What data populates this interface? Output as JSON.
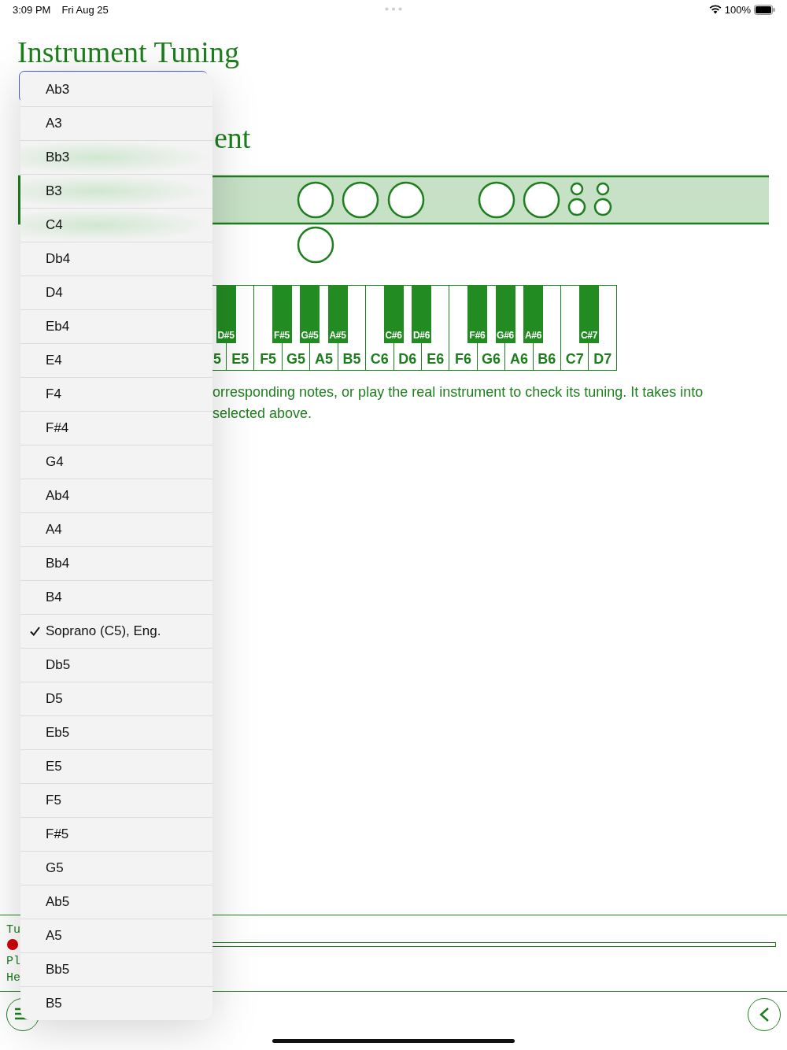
{
  "status_bar": {
    "time": "3:09 PM",
    "date": "Fri Aug 25",
    "battery": "100%"
  },
  "title": "Instrument Tuning",
  "heading_fragment": "ent",
  "keyboard": {
    "white_keys": [
      {
        "label": "5",
        "sharp": "D#5"
      },
      {
        "label": "E5"
      },
      {
        "label": "F5",
        "sharp": "F#5"
      },
      {
        "label": "G5",
        "sharp": "G#5"
      },
      {
        "label": "A5",
        "sharp": "A#5"
      },
      {
        "label": "B5"
      },
      {
        "label": "C6",
        "sharp": "C#6"
      },
      {
        "label": "D6",
        "sharp": "D#6"
      },
      {
        "label": "E6"
      },
      {
        "label": "F6",
        "sharp": "F#6"
      },
      {
        "label": "G6",
        "sharp": "G#6"
      },
      {
        "label": "A6",
        "sharp": "A#6"
      },
      {
        "label": "B6"
      },
      {
        "label": "C7",
        "sharp": "C#7"
      },
      {
        "label": "D7"
      }
    ]
  },
  "paragraph_lines": [
    "orresponding notes, or play the real instrument to check its tuning. It takes into",
    "selected above."
  ],
  "level_bar": {
    "level": 0
  },
  "console": [
    {
      "kind": "text",
      "text": "Tu"
    },
    {
      "kind": "dot"
    },
    {
      "kind": "text",
      "text": "Pl"
    },
    {
      "kind": "text",
      "text": "He"
    }
  ],
  "menu": {
    "items": [
      {
        "label": "Ab3",
        "selected": false
      },
      {
        "label": "A3",
        "selected": false
      },
      {
        "label": "Bb3",
        "selected": false
      },
      {
        "label": "B3",
        "selected": false
      },
      {
        "label": "C4",
        "selected": false
      },
      {
        "label": "Db4",
        "selected": false
      },
      {
        "label": "D4",
        "selected": false
      },
      {
        "label": "Eb4",
        "selected": false
      },
      {
        "label": "E4",
        "selected": false
      },
      {
        "label": "F4",
        "selected": false
      },
      {
        "label": "F#4",
        "selected": false
      },
      {
        "label": "G4",
        "selected": false
      },
      {
        "label": "Ab4",
        "selected": false
      },
      {
        "label": "A4",
        "selected": false
      },
      {
        "label": "Bb4",
        "selected": false
      },
      {
        "label": "B4",
        "selected": false
      },
      {
        "label": "Soprano (C5), Eng.",
        "selected": true
      },
      {
        "label": "Db5",
        "selected": false
      },
      {
        "label": "D5",
        "selected": false
      },
      {
        "label": "Eb5",
        "selected": false
      },
      {
        "label": "E5",
        "selected": false
      },
      {
        "label": "F5",
        "selected": false
      },
      {
        "label": "F#5",
        "selected": false
      },
      {
        "label": "G5",
        "selected": false
      },
      {
        "label": "Ab5",
        "selected": false
      },
      {
        "label": "A5",
        "selected": false
      },
      {
        "label": "Bb5",
        "selected": false
      },
      {
        "label": "B5",
        "selected": false
      }
    ]
  }
}
